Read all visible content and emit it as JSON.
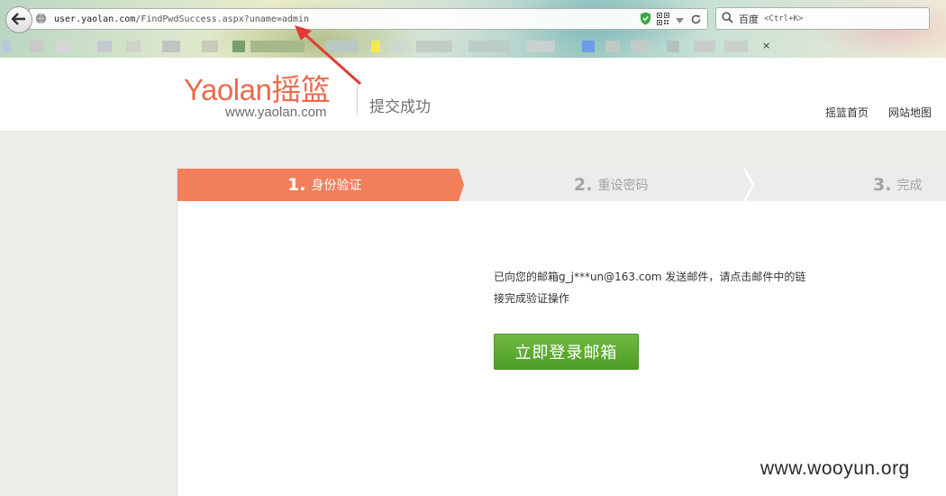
{
  "browser": {
    "url_host": "user.yaolan.com",
    "url_path": "/FindPwdSuccess.aspx?uname=admin",
    "search_engine": "百度",
    "search_shortcut": "<Ctrl+K>",
    "bookmarks_close": "×"
  },
  "site": {
    "logo_text": "Yaolan摇篮",
    "logo_url": "www.yaolan.com",
    "page_subtitle": "提交成功",
    "nav": [
      "摇篮首页",
      "网站地图"
    ]
  },
  "steps": [
    {
      "num": "1.",
      "label": "身份验证",
      "active": true
    },
    {
      "num": "2.",
      "label": "重设密码",
      "active": false
    },
    {
      "num": "3.",
      "label": "完成",
      "active": false
    }
  ],
  "message": {
    "line1": "已向您的邮箱g_j***un@163.com 发送邮件，请点击邮件中的链",
    "line2": "接完成验证操作"
  },
  "login_button": "立即登录邮箱",
  "watermark": "www.wooyun.org",
  "colors": {
    "accent": "#f27e5a",
    "button": "#5aa82f",
    "logo": "#ec6a4d",
    "arrow": "#e53935"
  }
}
